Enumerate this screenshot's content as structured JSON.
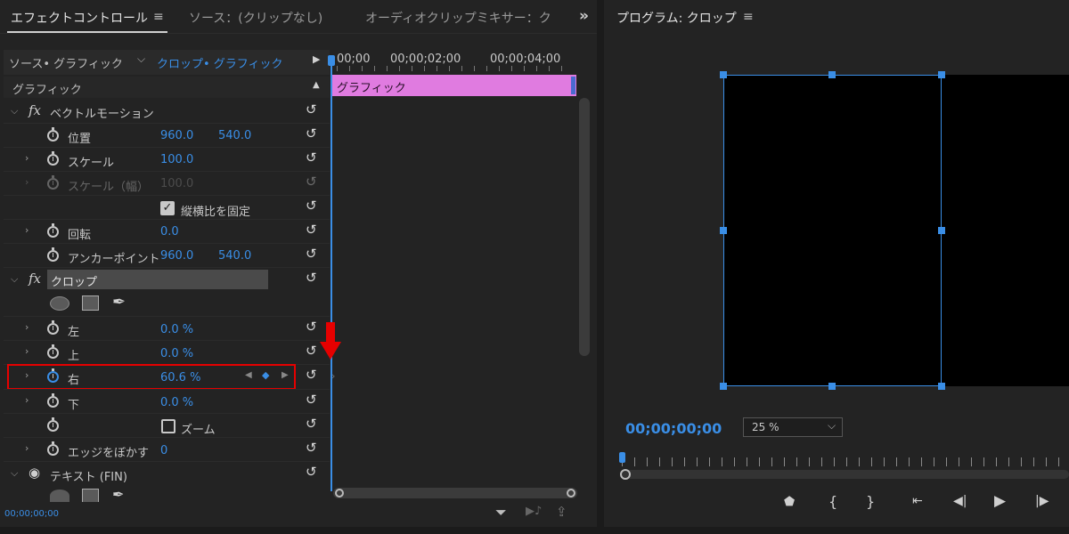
{
  "left": {
    "tabs": [
      "エフェクトコントロール",
      "ソース：(クリップなし)",
      "オーディオクリップミキサー：クロ"
    ],
    "tab_menu_icon": "hamburger-icon",
    "overflow": "»",
    "source_label": "ソース• グラフィック",
    "clip_label": "クロップ• グラフィック",
    "section_label": "グラフィック",
    "timecodes": [
      "00;00",
      "00;00;02;00",
      "00;00;04;00"
    ],
    "clip_name": "グラフィック",
    "bottom_timecode": "00;00;00;00",
    "vector_motion": {
      "name": "ベクトルモーション",
      "position_label": "位置",
      "position_x": "960.0",
      "position_y": "540.0",
      "scale_label": "スケール",
      "scale_value": "100.0",
      "scale_width_label": "スケール（幅）",
      "scale_width_value": "100.0",
      "uniform_label": "縦横比を固定",
      "rotation_label": "回転",
      "rotation_value": "0.0",
      "anchor_label": "アンカーポイント",
      "anchor_x": "960.0",
      "anchor_y": "540.0"
    },
    "crop": {
      "name": "クロップ",
      "left_label": "左",
      "left_value": "0.0 %",
      "top_label": "上",
      "top_value": "0.0 %",
      "right_label": "右",
      "right_value": "60.6 %",
      "bottom_label": "下",
      "bottom_value": "0.0 %",
      "zoom_label": "ズーム",
      "feather_label": "エッジをぼかす",
      "feather_value": "0"
    },
    "text_layer": {
      "name": "テキスト (FIN)"
    }
  },
  "right": {
    "title": "プログラム: クロップ",
    "timecode": "00;00;00;00",
    "zoom": "25 %"
  },
  "colors": {
    "accent": "#3a8ee6",
    "highlight": "#e60000",
    "clip": "#e07be0"
  }
}
